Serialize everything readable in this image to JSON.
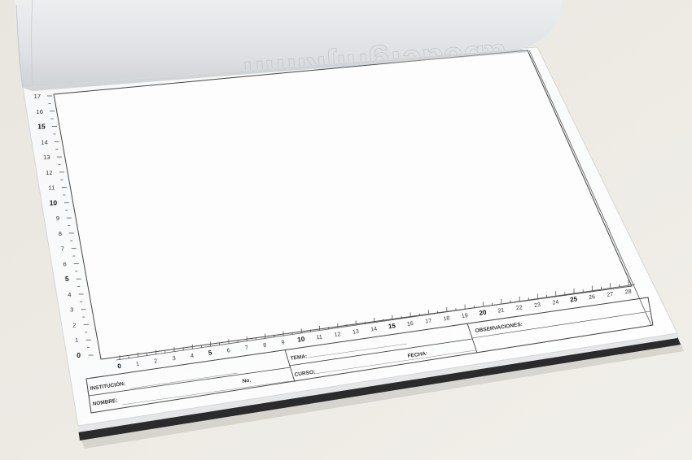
{
  "colors": {
    "background": "#ebe8e1",
    "sheet": "#fbfbfb",
    "curled_page": "#e3e5e7",
    "border_line": "#555555"
  },
  "curled_page": {
    "watermark_text": "abcdefghijklmn"
  },
  "ruler_vertical": {
    "labels": [
      "0",
      "1",
      "2",
      "3",
      "4",
      "5",
      "6",
      "7",
      "8",
      "9",
      "10",
      "11",
      "12",
      "13",
      "14",
      "15",
      "16",
      "17"
    ],
    "major": [
      "0",
      "5",
      "10",
      "15"
    ]
  },
  "ruler_horizontal": {
    "labels": [
      "0",
      "1",
      "2",
      "3",
      "4",
      "5",
      "6",
      "7",
      "8",
      "9",
      "10",
      "11",
      "12",
      "13",
      "14",
      "15",
      "16",
      "17",
      "18",
      "19",
      "20",
      "21",
      "22",
      "23",
      "24",
      "25",
      "26",
      "27",
      "28"
    ],
    "major": [
      "0",
      "5",
      "10",
      "15",
      "20",
      "25"
    ]
  },
  "title_block": {
    "institucion": "INSTITUCIÓN:",
    "no": "No.",
    "nombre": "NOMBRE:",
    "tema": "TEMA:",
    "fecha": "FECHA:",
    "curso": "CURSO:",
    "observaciones": "OBSERVACIONES:"
  }
}
